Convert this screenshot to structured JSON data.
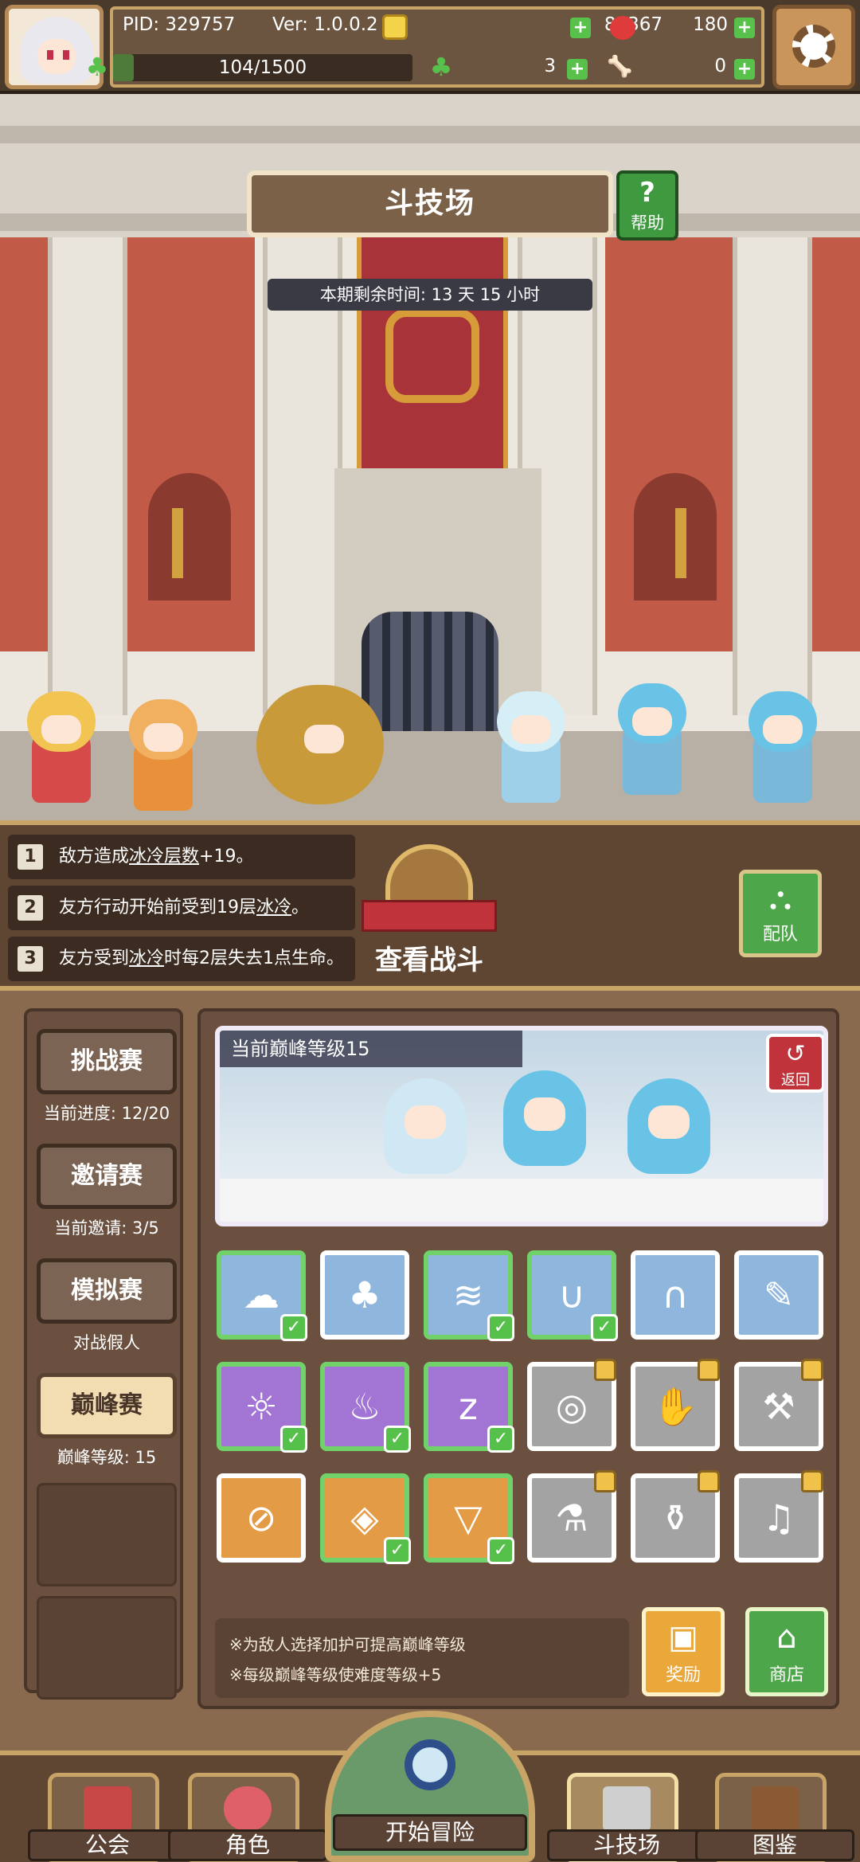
{
  "topbar": {
    "pid": "PID: 329757",
    "version": "Ver: 1.0.0.2",
    "gold": "80367",
    "apples": "180",
    "energy": "104/1500",
    "clovers": "3",
    "bones": "0",
    "energy_fill": 0.069
  },
  "arena": {
    "title": "斗技场",
    "help_label": "帮助",
    "remaining_time": "本期剩余时间: 13 天 15 小时"
  },
  "effects": [
    {
      "num": "1",
      "pre": "敌方造成",
      "key": "冰冷层数",
      "post": "+19。"
    },
    {
      "num": "2",
      "pre": "友方行动开始前受到19层",
      "key": "冰冷",
      "post": "。"
    },
    {
      "num": "3",
      "pre": "友方受到",
      "key": "冰冷",
      "post": "时每2层失去1点生命。"
    }
  ],
  "battle": {
    "view_label": "查看战斗",
    "team_label": "配队"
  },
  "modes": [
    {
      "label": "挑战赛",
      "sub": "当前进度: 12/20"
    },
    {
      "label": "邀请赛",
      "sub": "当前邀请: 3/5"
    },
    {
      "label": "模拟赛",
      "sub": "对战假人"
    },
    {
      "label": "巅峰赛",
      "sub": "巅峰等级: 15"
    }
  ],
  "peak": {
    "title": "当前巅峰等级15",
    "return_label": "返回"
  },
  "notes": [
    "※为敌人选择加护可提高巅峰等级",
    "※每级巅峰等级使难度等级+5"
  ],
  "actions": {
    "reward_label": "奖励",
    "shop_label": "商店"
  },
  "nav": {
    "guild": "公会",
    "character": "角色",
    "adventure": "开始冒险",
    "arena": "斗技场",
    "codex": "图鉴"
  },
  "colors": {
    "selected_border": "#72d26a",
    "check_green": "#55c14b",
    "ice_blue": "#68c3e6"
  },
  "blessings": [
    {
      "icon": "cloud-icon",
      "color": "blue",
      "selected": true
    },
    {
      "icon": "tree-icon",
      "color": "blue",
      "selected": false
    },
    {
      "icon": "tornado-icon",
      "color": "blue",
      "selected": true
    },
    {
      "icon": "magnet-icon",
      "color": "blue",
      "selected": true
    },
    {
      "icon": "gate-icon",
      "color": "blue",
      "selected": false
    },
    {
      "icon": "feather-icon",
      "color": "blue",
      "selected": false
    },
    {
      "icon": "sun-icon",
      "color": "purple",
      "selected": true
    },
    {
      "icon": "fire-icon",
      "color": "purple",
      "selected": true
    },
    {
      "icon": "sleep-icon",
      "color": "purple",
      "selected": true
    },
    {
      "icon": "swirl-icon",
      "color": "gray",
      "locked": true
    },
    {
      "icon": "claw-icon",
      "color": "gray",
      "locked": true
    },
    {
      "icon": "pickaxe-icon",
      "color": "gray",
      "locked": true
    },
    {
      "icon": "coin-icon",
      "color": "orange",
      "selected": false
    },
    {
      "icon": "eye-icon",
      "color": "orange",
      "selected": true
    },
    {
      "icon": "funnel-icon",
      "color": "orange",
      "selected": true
    },
    {
      "icon": "potion-icon",
      "color": "gray",
      "locked": true
    },
    {
      "icon": "flask-icon",
      "color": "gray",
      "locked": true
    },
    {
      "icon": "bell-icon",
      "color": "gray",
      "locked": true
    }
  ]
}
